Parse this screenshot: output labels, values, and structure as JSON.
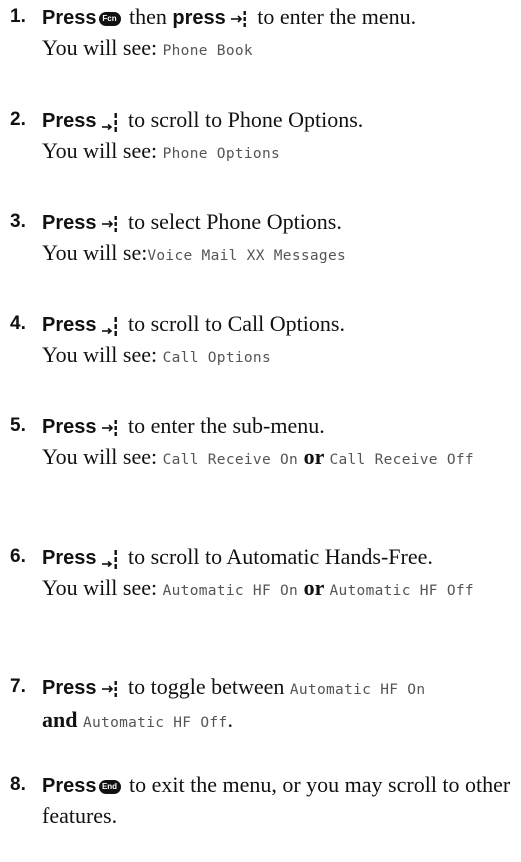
{
  "steps": [
    {
      "num": "1.",
      "press": "Press",
      "key1": "Fcn",
      "mid": " then ",
      "press2": "press",
      "rest": " to enter the menu.",
      "see_label": "You will see:",
      "display": "Phone Book"
    },
    {
      "num": "2.",
      "press": "Press",
      "rest": " to scroll to Phone Options.",
      "see_label": "You will see:",
      "display": "Phone Options"
    },
    {
      "num": "3.",
      "press": "Press",
      "rest": " to select Phone Options.",
      "see_label": "You will se:",
      "display": "Voice Mail XX Messages"
    },
    {
      "num": "4.",
      "press": "Press",
      "rest": " to scroll to Call Options.",
      "see_label": "You will see: ",
      "display": "Call Options"
    },
    {
      "num": "5.",
      "press": "Press",
      "rest": " to enter the sub-menu.",
      "see_label": "You will see:",
      "display_a": "Call Receive On",
      "or": " or ",
      "display_b": "Call Receive Off"
    },
    {
      "num": "6.",
      "press": "Press",
      "rest": " to scroll to Automatic Hands-Free.",
      "see_label": "You will see:",
      "display_a": "Automatic HF On",
      "or": " or ",
      "display_b": "Automatic HF Off"
    },
    {
      "num": "7.",
      "press": "Press",
      "rest": " to toggle between ",
      "display_a": "Automatic HF On",
      "and": "and ",
      "display_b": "Automatic HF Off",
      "end": "."
    },
    {
      "num": "8.",
      "press": "Press",
      "key1": "End",
      "rest": " to exit the menu, or you may scroll to other features."
    }
  ]
}
